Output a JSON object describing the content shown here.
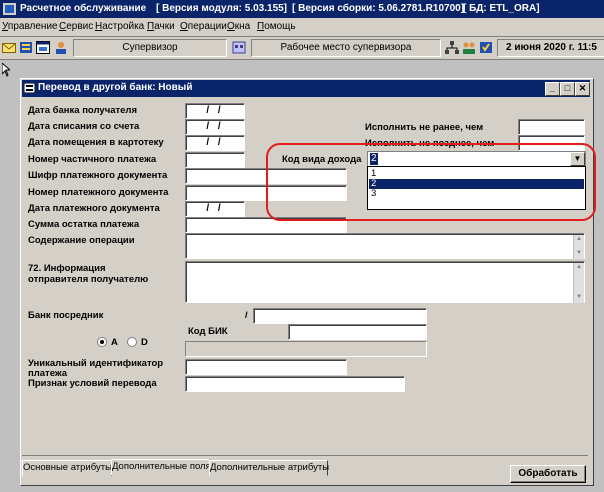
{
  "app": {
    "title": "Расчетное обслуживание",
    "module_version": "[ Версия модуля: 5.03.155]",
    "build_version": "[ Версия сборки: 5.06.2781.R10700]",
    "db": "[ БД: ETL_ORA]"
  },
  "menu": [
    "Управление",
    "Сервис",
    "Настройка",
    "Пачки",
    "Операции",
    "Окна",
    "Помощь"
  ],
  "toolbar": {
    "role": "Супервизор",
    "workplace": "Рабочее место супервизора",
    "datetime": "2 июня 2020 г. 11:5"
  },
  "dialog": {
    "title": "Перевод в другой банк: Новый",
    "labels": {
      "recipient_bank_date": "Дата банка получателя",
      "debit_date": "Дата списания со счета",
      "card_index_date": "Дата помещения в картотеку",
      "partial_payment_no": "Номер частичного платежа",
      "doc_cipher": "Шифр платежного документа",
      "doc_number": "Номер платежного документа",
      "doc_date": "Дата платежного документа",
      "remaining_sum": "Сумма остатка платежа",
      "operation_content": "Содержание операции",
      "recipient_info_1": "72. Информация",
      "recipient_info_2": "отправителя получателю",
      "intermediary_bank": "Банк посредник",
      "bik_code": "Код БИК",
      "unique_id_1": "Уникальный идентификатор",
      "unique_id_2": "платежа",
      "transfer_terms": "Признак условий перевода",
      "execute_not_before": "Исполнить не ранее, чем",
      "execute_not_after": "Исполнить не позднее, чем",
      "income_type_code": "Код вида дохода"
    },
    "date_placeholder": "/  /",
    "slash": "/",
    "income_type": {
      "value": "2",
      "options": [
        "1",
        "2",
        "3"
      ],
      "selected_option": "2"
    },
    "radio": {
      "a_label": "А",
      "d_label": "D",
      "selected": "А"
    },
    "tabs": [
      "Основные атрибуты",
      "Дополнительные поля",
      "Дополнительные атрибуты"
    ],
    "active_tab": "Дополнительные поля",
    "process_button": "Обработать"
  },
  "colors": {
    "titlebar": "#0a246a",
    "face": "#d4d0c8",
    "highlight_border": "#e01c1c"
  }
}
